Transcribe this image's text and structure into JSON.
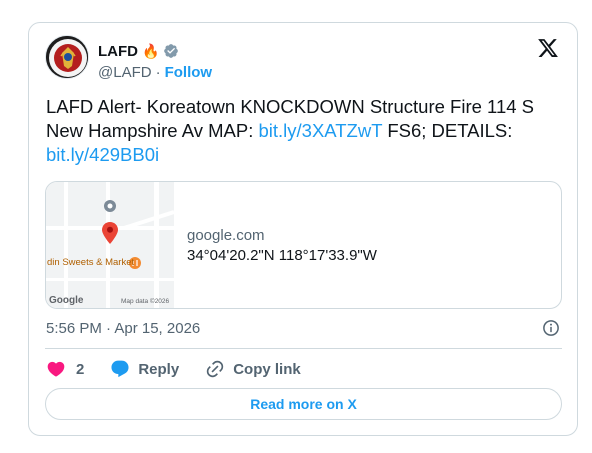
{
  "author": {
    "name": "LAFD",
    "name_emoji": "🔥",
    "handle": "@LAFD",
    "separator": "·",
    "follow_label": "Follow"
  },
  "tweet": {
    "text_1": "LAFD Alert- Koreatown KNOCKDOWN Structure Fire 114 S New Hampshire Av MAP: ",
    "link_1": "bit.ly/3XATZwT",
    "text_2": " FS6; DETAILS: ",
    "link_2": "bit.ly/429BB0i"
  },
  "link_card": {
    "domain": "google.com",
    "coords": "34°04'20.2\"N 118°17'33.9\"W",
    "map_place_label": "din Sweets & Market",
    "map_logo": "Google",
    "map_attribution": "Map data ©2026"
  },
  "timestamp": "5:56 PM · Apr 15, 2026",
  "actions": {
    "like_count": "2",
    "reply_label": "Reply",
    "copy_label": "Copy link"
  },
  "read_more_label": "Read more on X",
  "colors": {
    "accent": "#1d9bf0",
    "like": "#f91880",
    "text": "#0f1419",
    "muted": "#536471",
    "border": "#cfd9de"
  },
  "icons": [
    "avatar-seal",
    "fire-emoji",
    "verified-badge-icon",
    "x-logo-icon",
    "map-pin-icon",
    "info-icon",
    "heart-icon",
    "reply-bubble-icon",
    "copy-link-icon"
  ]
}
